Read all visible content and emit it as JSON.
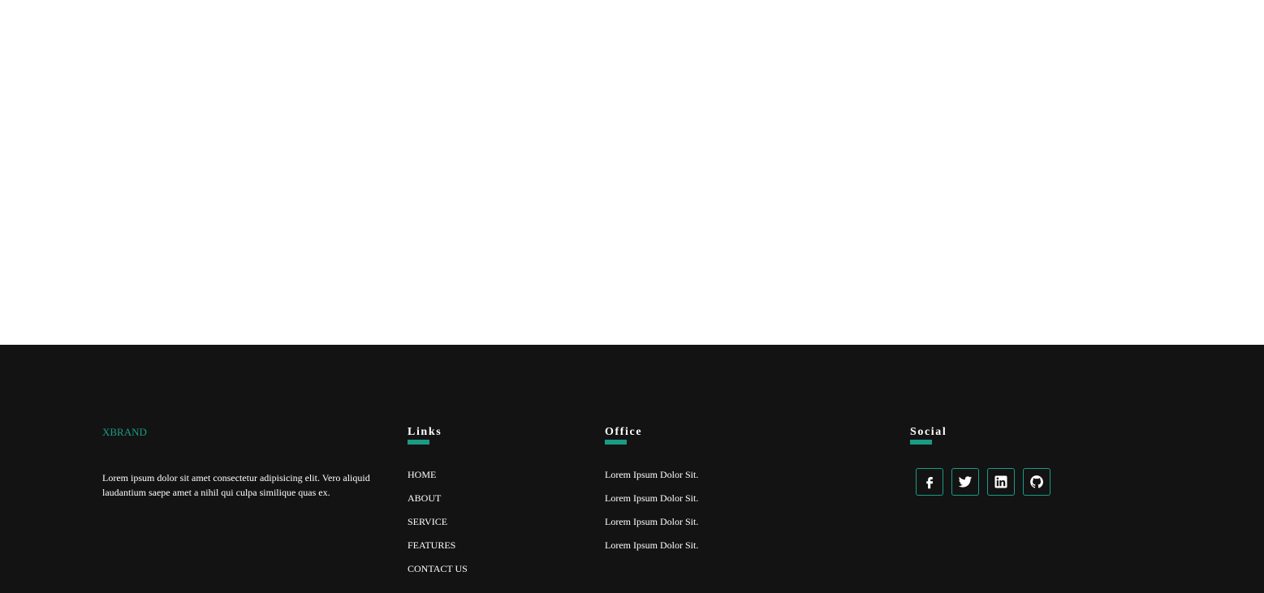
{
  "brand": {
    "name": "XBRAND",
    "description": "Lorem ipsum dolor sit amet consectetur adipisicing elit. Vero aliquid laudantium saepe amet a nihil qui culpa similique quas ex.",
    "accent_color": "#1a9b85"
  },
  "links": {
    "title": "Links",
    "items": [
      {
        "label": "HOME"
      },
      {
        "label": "ABOUT"
      },
      {
        "label": "SERVICE"
      },
      {
        "label": "FEATURES"
      },
      {
        "label": "CONTACT US"
      }
    ]
  },
  "office": {
    "title": "Office",
    "items": [
      {
        "text": "Lorem Ipsum Dolor Sit."
      },
      {
        "text": "Lorem Ipsum Dolor Sit."
      },
      {
        "text": "Lorem Ipsum Dolor Sit."
      },
      {
        "text": "Lorem Ipsum Dolor Sit."
      }
    ]
  },
  "social": {
    "title": "Social",
    "icons": [
      "facebook-icon",
      "twitter-icon",
      "linkedin-icon",
      "github-icon"
    ]
  },
  "colors": {
    "footer_background": "#131313",
    "page_background": "#ffffff",
    "text": "#ffffff"
  }
}
